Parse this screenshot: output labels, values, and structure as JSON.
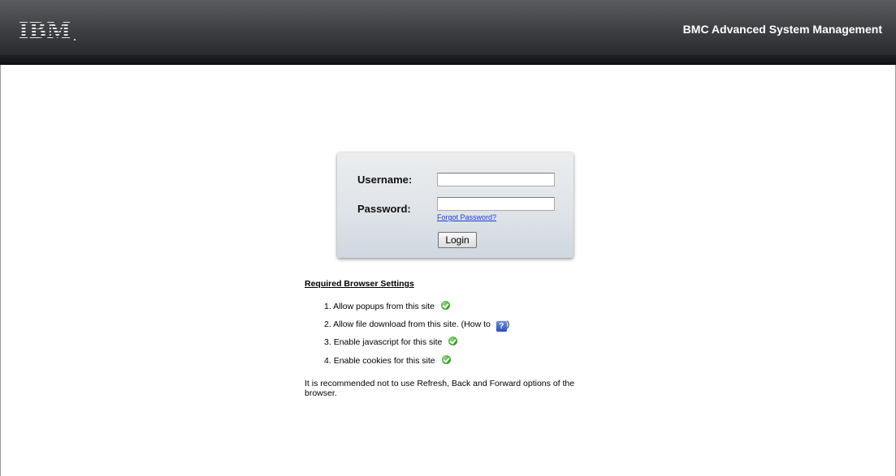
{
  "header": {
    "logo_text": "IBM",
    "app_title": "BMC Advanced System Management"
  },
  "login": {
    "username_label": "Username:",
    "password_label": "Password:",
    "username_value": "",
    "password_value": "",
    "forgot_password": "Forgot Password?",
    "login_button": "Login"
  },
  "settings": {
    "title": "Required Browser Settings",
    "items": [
      {
        "number": "1.",
        "text": "Allow popups from this site",
        "icon": "check-icon"
      },
      {
        "number": "2.",
        "text": "Allow file download from this site. (How to",
        "icon": "help-icon",
        "suffix": ")"
      },
      {
        "number": "3.",
        "text": "Enable javascript for this site",
        "icon": "check-icon"
      },
      {
        "number": "4.",
        "text": "Enable cookies for this site",
        "icon": "check-icon"
      }
    ],
    "note": "It is recommended not to use Refresh, Back and Forward options of the browser."
  }
}
